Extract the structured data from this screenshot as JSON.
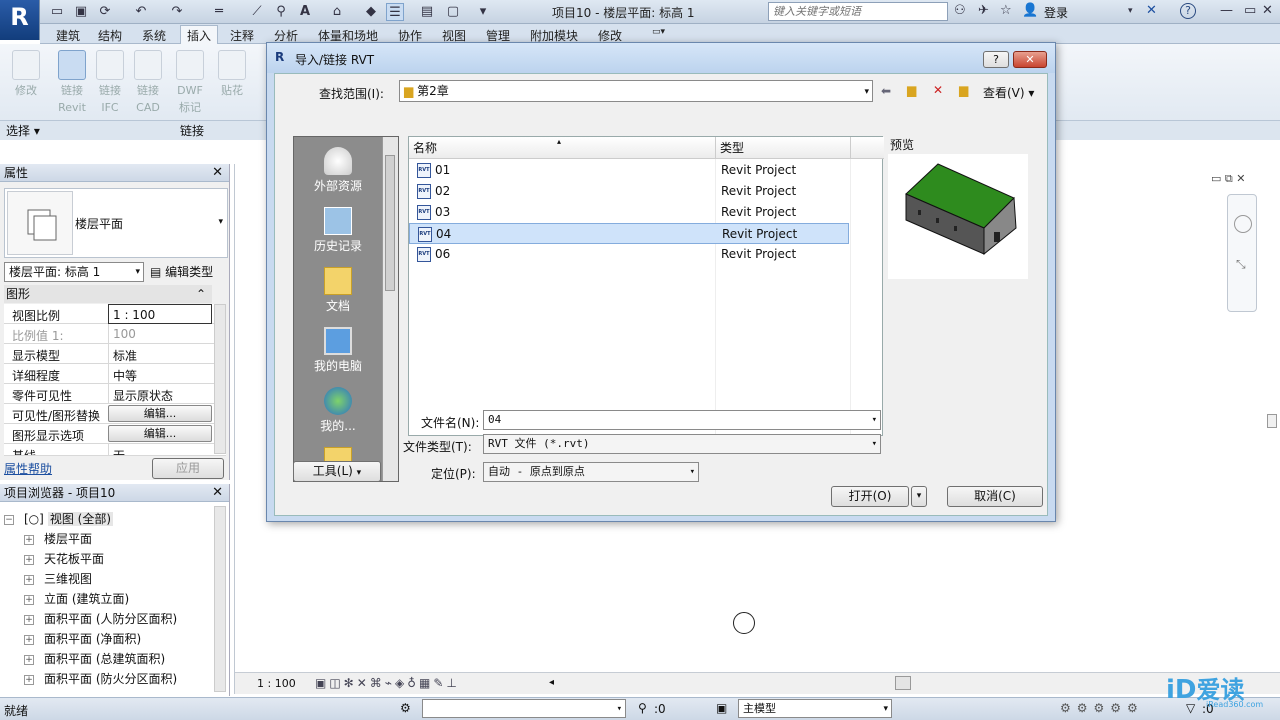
{
  "app": {
    "logo": "R",
    "window_title": "项目10 - 楼层平面: 标高 1",
    "search_placeholder": "键入关键字或短语",
    "login": "登录"
  },
  "ribbon": {
    "tabs": [
      "建筑",
      "结构",
      "系统",
      "插入",
      "注释",
      "分析",
      "体量和场地",
      "协作",
      "视图",
      "管理",
      "附加模块",
      "修改"
    ],
    "active_tab": "插入",
    "buttons": [
      {
        "line1": "修改",
        "line2": ""
      },
      {
        "line1": "链接",
        "line2": "Revit"
      },
      {
        "line1": "链接",
        "line2": "IFC"
      },
      {
        "line1": "链接",
        "line2": "CAD"
      },
      {
        "line1": "DWF",
        "line2": "标记"
      },
      {
        "line1": "贴花",
        "line2": ""
      }
    ],
    "panel_select": "选择",
    "panel_link": "链接"
  },
  "properties": {
    "title": "属性",
    "type_name": "楼层平面",
    "instance_selector": "楼层平面: 标高 1",
    "edit_type": "编辑类型",
    "group": "图形",
    "rows": [
      {
        "key": "视图比例",
        "value": "1 : 100"
      },
      {
        "key": "比例值 1:",
        "value": "100"
      },
      {
        "key": "显示模型",
        "value": "标准"
      },
      {
        "key": "详细程度",
        "value": "中等"
      },
      {
        "key": "零件可见性",
        "value": "显示原状态"
      },
      {
        "key": "可见性/图形替换",
        "value": "编辑..."
      },
      {
        "key": "图形显示选项",
        "value": "编辑..."
      },
      {
        "key": "基线",
        "value": "无"
      }
    ],
    "help": "属性帮助",
    "apply": "应用"
  },
  "browser": {
    "title": "项目浏览器 - 项目10",
    "root": "视图 (全部)",
    "items": [
      "楼层平面",
      "天花板平面",
      "三维视图",
      "立面 (建筑立面)",
      "面积平面 (人防分区面积)",
      "面积平面 (净面积)",
      "面积平面 (总建筑面积)",
      "面积平面 (防火分区面积)"
    ]
  },
  "view_bar": {
    "scale": "1 : 100"
  },
  "status": {
    "text": "就绪",
    "zero": ":0",
    "model": "主模型",
    "zero2": ":0"
  },
  "dialog": {
    "title": "导入/链接 RVT",
    "help": "?",
    "lookin_label": "查找范围(I):",
    "lookin_value": "第2章",
    "view_menu": "查看(V)",
    "col_name": "名称",
    "col_type": "类型",
    "files": [
      {
        "name": "01",
        "type": "Revit Project",
        "icon": "RVT"
      },
      {
        "name": "02",
        "type": "Revit Project",
        "icon": "RVT"
      },
      {
        "name": "03",
        "type": "Revit Project",
        "icon": "RVT"
      },
      {
        "name": "04",
        "type": "Revit Project",
        "icon": "RVT"
      },
      {
        "name": "06",
        "type": "Revit Project",
        "icon": "RVT"
      }
    ],
    "selected_index": 3,
    "places": [
      "外部资源",
      "历史记录",
      "文档",
      "我的电脑",
      "我的..."
    ],
    "preview_label": "预览",
    "filename_label": "文件名(N):",
    "filename_value": "04",
    "filetype_label": "文件类型(T):",
    "filetype_value": "RVT 文件 (*.rvt)",
    "tools": "工具(L)",
    "position_label": "定位(P):",
    "position_value": "自动 - 原点到原点",
    "open": "打开(O)",
    "cancel": "取消(C)"
  },
  "watermark": {
    "text": "爱读",
    "sub": "iRead360.com"
  },
  "colors": {
    "roof": "#2e8b1e",
    "selection": "#cfe3fa",
    "titlebar": "#c6d3e2"
  }
}
